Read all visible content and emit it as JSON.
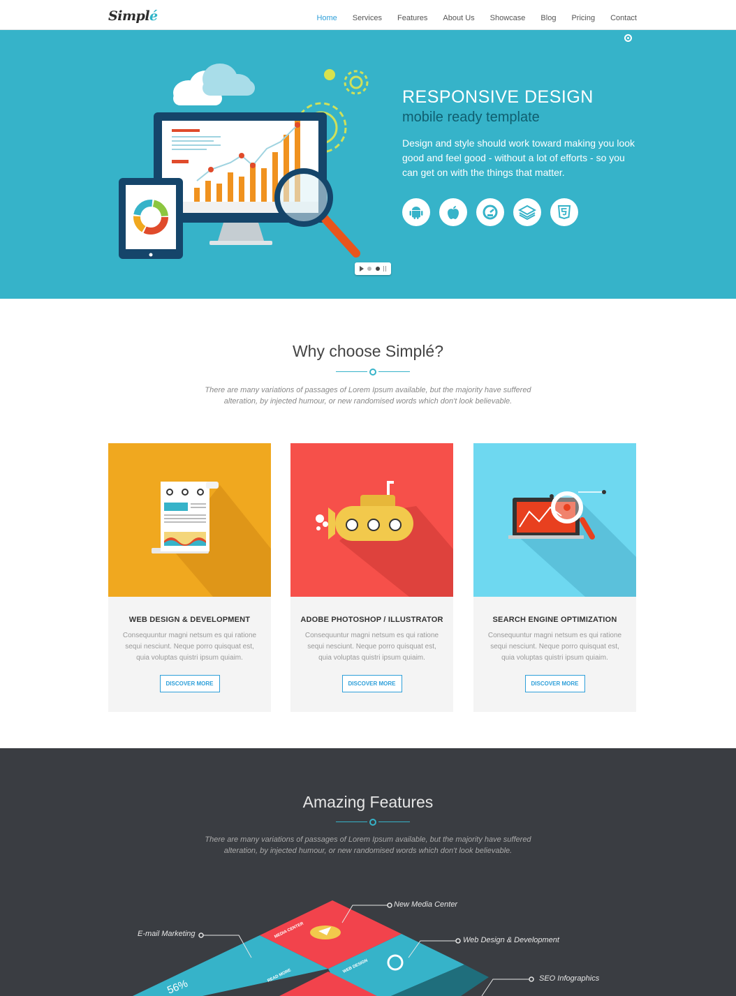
{
  "nav": {
    "logo_main": "Simpl",
    "logo_accent": "é",
    "items": [
      "Home",
      "Services",
      "Features",
      "About Us",
      "Showcase",
      "Blog",
      "Pricing",
      "Contact"
    ]
  },
  "hero": {
    "title": "RESPONSIVE DESIGN",
    "subtitle": "mobile ready template",
    "text": "Design and style should work toward making you look good and feel good - without a lot of efforts - so you can get on with the things that matter.",
    "icons": [
      "android-icon",
      "apple-icon",
      "speedometer-icon",
      "layers-icon",
      "html5-icon"
    ]
  },
  "why": {
    "title": "Why choose Simplé?",
    "description_line1": "There are many variations of passages of Lorem Ipsum available, but the majority have suffered",
    "description_line2": "alteration, by injected humour, or new randomised words which don't look believable."
  },
  "cards": [
    {
      "title": "WEB DESIGN & DEVELOPMENT",
      "text": "Consequuntur magni netsum es qui ratione sequi nesciunt. Neque porro quisquat est, quia voluptas quistri ipsum quiaim.",
      "button": "DISCOVER MORE",
      "color": "#f0a81f"
    },
    {
      "title": "ADOBE PHOTOSHOP / ILLUSTRATOR",
      "text": "Consequuntur magni netsum es qui ratione sequi nesciunt. Neque porro quisquat est, quia voluptas quistri ipsum quiaim.",
      "button": "DISCOVER MORE",
      "color": "#f6504a"
    },
    {
      "title": "SEARCH ENGINE OPTIMIZATION",
      "text": "Consequuntur magni netsum es qui ratione sequi nesciunt. Neque porro quisquat est, quia voluptas quistri ipsum quiaim.",
      "button": "DISCOVER MORE",
      "color": "#6ed8f0"
    }
  ],
  "features": {
    "title": "Amazing Features",
    "description_line1": "There are many variations of passages of Lorem Ipsum available, but the majority have suffered",
    "description_line2": "alteration, by injected humour, or new randomised words which don't look believable.",
    "labels": {
      "new_media": "New Media Center",
      "email": "E-mail Marketing",
      "web_design": "Web Design & Development",
      "seo": "SEO Infographics"
    },
    "tile_labels": [
      "MEDIA CENTER",
      "WEB DESIGN",
      "READ MORE",
      "56%"
    ]
  },
  "colors": {
    "accent": "#36b3c9",
    "link": "#2e9fd9",
    "dark": "#3a3d42"
  }
}
